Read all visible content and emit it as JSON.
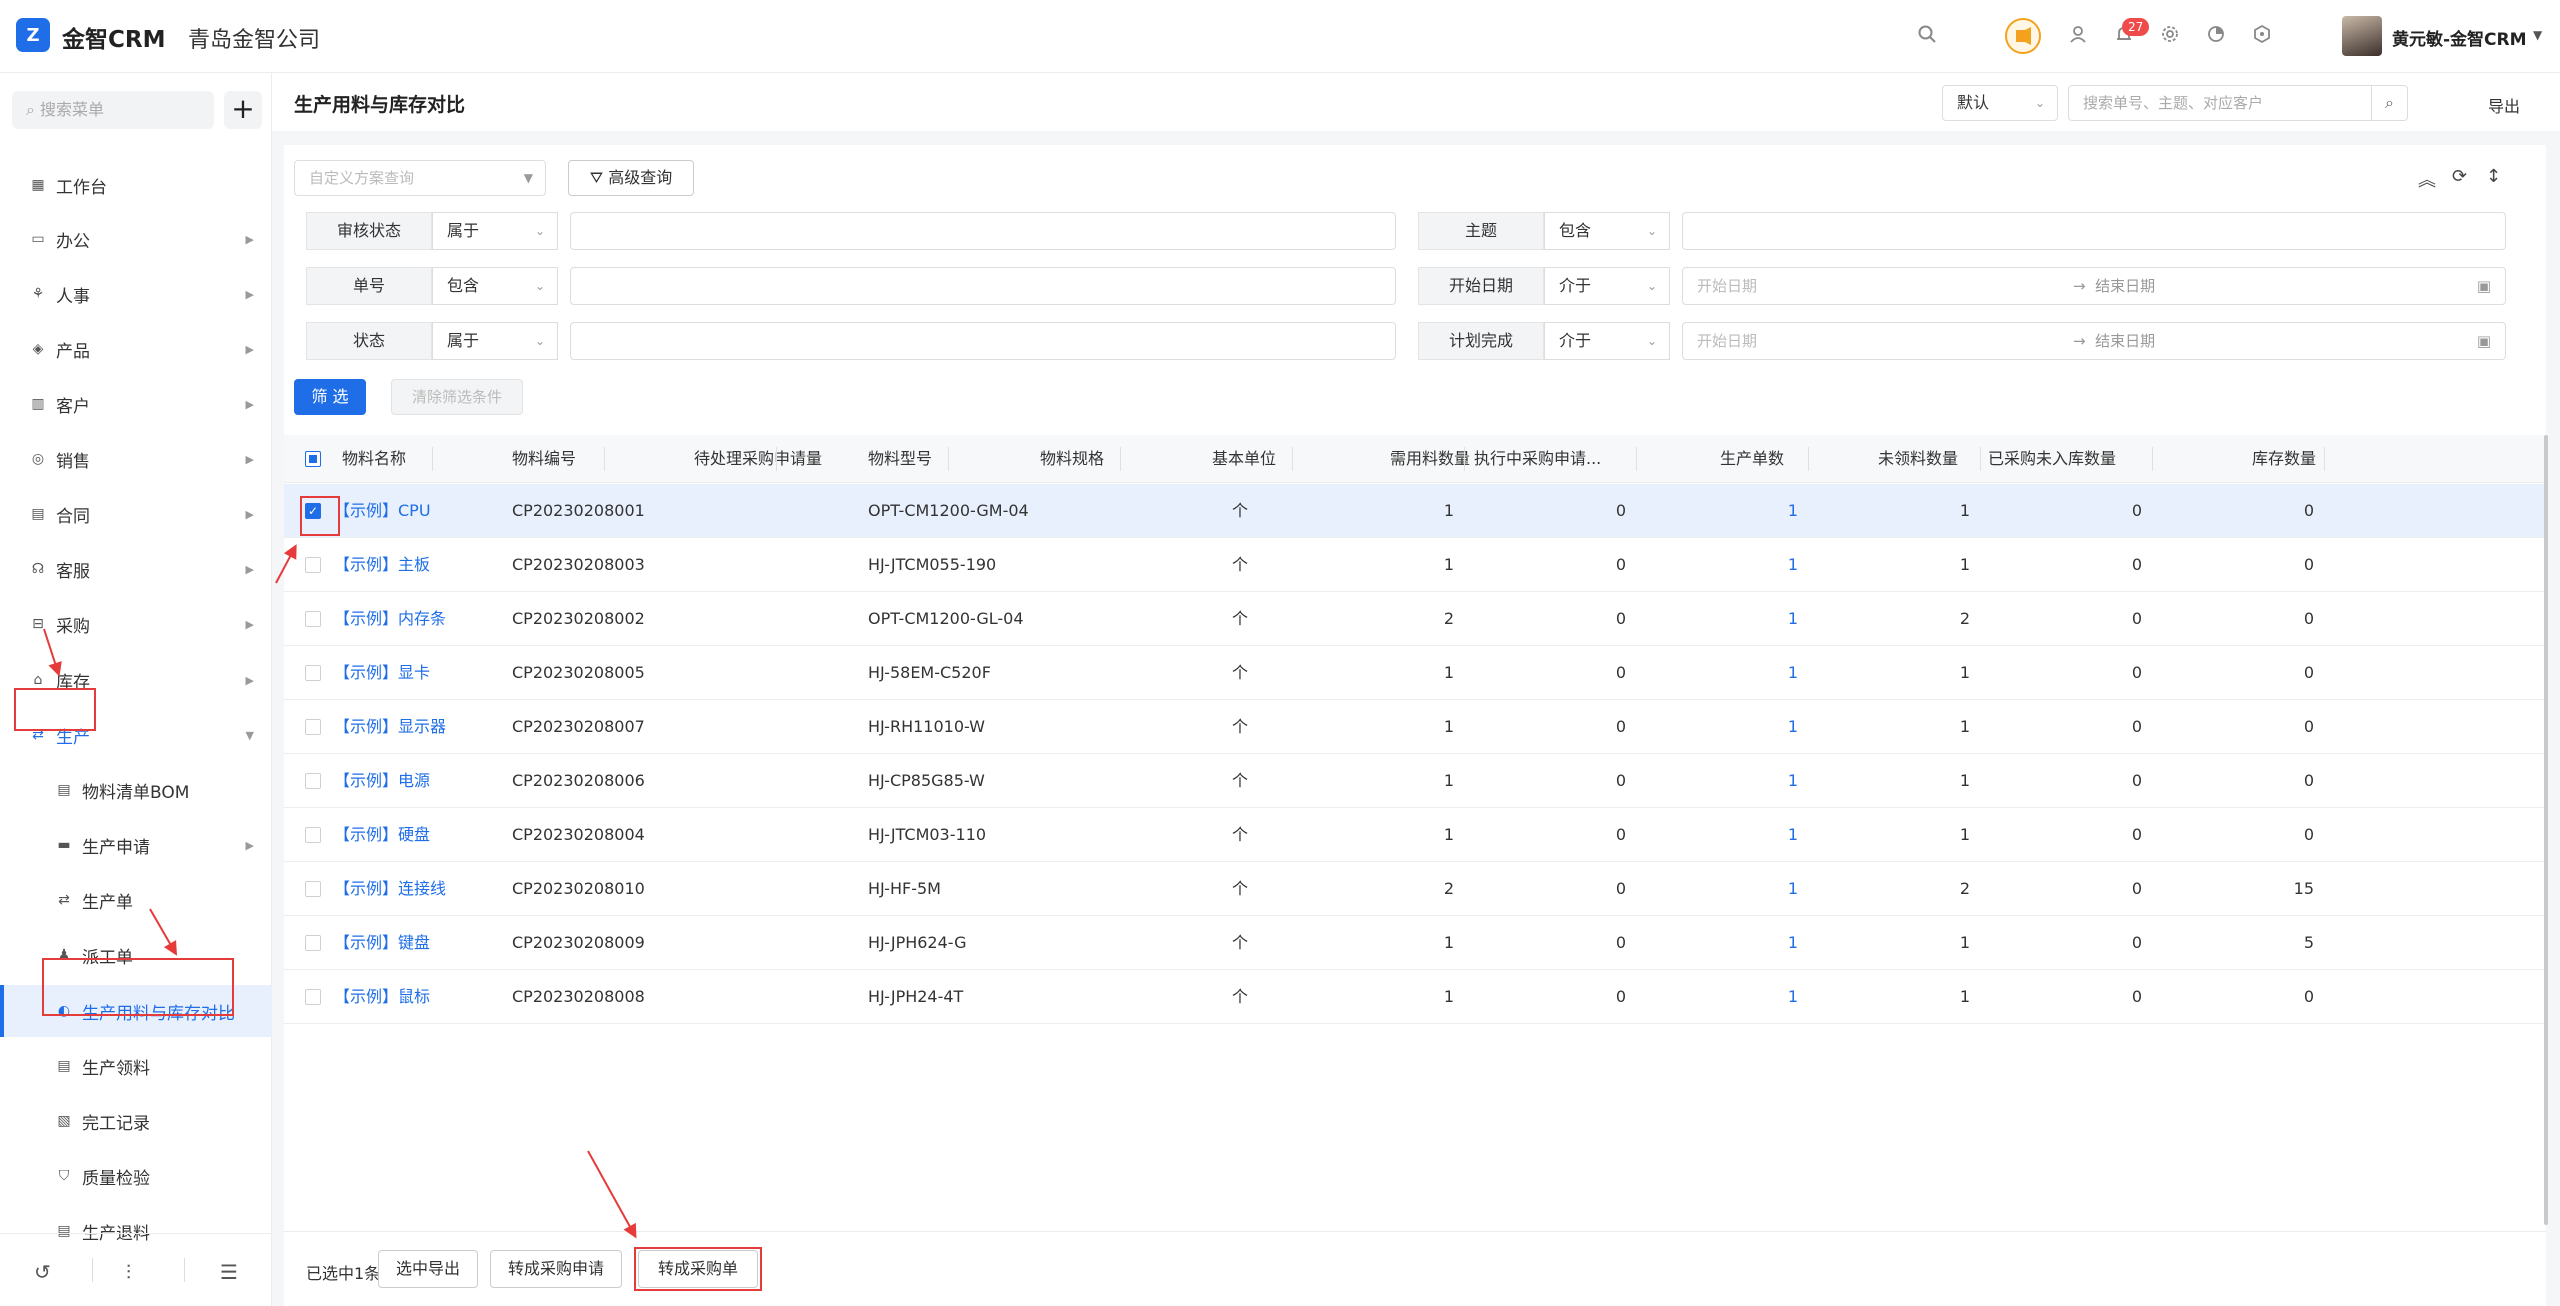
{
  "app": {
    "logo_mark": "Z",
    "logo_text": "金智CRM",
    "company": "青岛金智公司",
    "user_name": "黄元敏-金智CRM",
    "notification_count": "27"
  },
  "colors": {
    "primary": "#1f6ee8",
    "annotation": "#e63b3b"
  },
  "sidebar": {
    "search_placeholder": "搜索菜单",
    "items": [
      {
        "label": "工作台",
        "icon": "dashboard-icon"
      },
      {
        "label": "办公",
        "icon": "office-icon"
      },
      {
        "label": "人事",
        "icon": "hr-icon"
      },
      {
        "label": "产品",
        "icon": "product-icon"
      },
      {
        "label": "客户",
        "icon": "customer-icon"
      },
      {
        "label": "销售",
        "icon": "sales-icon"
      },
      {
        "label": "合同",
        "icon": "contract-icon"
      },
      {
        "label": "客服",
        "icon": "service-icon"
      },
      {
        "label": "采购",
        "icon": "purchase-icon"
      },
      {
        "label": "库存",
        "icon": "inventory-icon"
      },
      {
        "label": "生产",
        "icon": "production-icon"
      }
    ],
    "sub_items": [
      {
        "label": "物料清单BOM"
      },
      {
        "label": "生产申请"
      },
      {
        "label": "生产单"
      },
      {
        "label": "派工单"
      },
      {
        "label": "生产用料与库存对比"
      },
      {
        "label": "生产领料"
      },
      {
        "label": "完工记录"
      },
      {
        "label": "质量检验"
      },
      {
        "label": "生产退料"
      }
    ]
  },
  "page": {
    "title": "生产用料与库存对比",
    "view_select": "默认",
    "search_placeholder": "搜索单号、主题、对应客户",
    "export": "导出"
  },
  "filters": {
    "scheme_placeholder": "自定义方案查询",
    "advanced": "高级查询",
    "rows": [
      {
        "label": "审核状态",
        "op": "属于"
      },
      {
        "label": "单号",
        "op": "包含"
      },
      {
        "label": "状态",
        "op": "属于"
      }
    ],
    "right_rows": [
      {
        "label": "主题",
        "op": "包含"
      },
      {
        "label": "开始日期",
        "op": "介于",
        "start": "开始日期",
        "end": "结束日期"
      },
      {
        "label": "计划完成",
        "op": "介于",
        "start": "开始日期",
        "end": "结束日期"
      }
    ],
    "range_arrow": "→",
    "filter_btn": "筛 选",
    "clear_btn": "清除筛选条件"
  },
  "table": {
    "headers": [
      "物料名称",
      "物料编号",
      "待处理采购申请量",
      "物料型号",
      "物料规格",
      "基本单位",
      "需用料数量",
      "执行中采购申请...",
      "生产单数",
      "未领料数量",
      "已采购未入库数量",
      "库存数量"
    ],
    "rows": [
      {
        "name": "【示例】CPU",
        "code": "CP20230208001",
        "model": "OPT-CM1200-GM-04",
        "unit": "个",
        "need": "1",
        "exec": "0",
        "orders": "1",
        "unpicked": "1",
        "purchased": "0",
        "stock": "0",
        "checked": true
      },
      {
        "name": "【示例】主板",
        "code": "CP20230208003",
        "model": "HJ-JTCM055-190",
        "unit": "个",
        "need": "1",
        "exec": "0",
        "orders": "1",
        "unpicked": "1",
        "purchased": "0",
        "stock": "0",
        "checked": false
      },
      {
        "name": "【示例】内存条",
        "code": "CP20230208002",
        "model": "OPT-CM1200-GL-04",
        "unit": "个",
        "need": "2",
        "exec": "0",
        "orders": "1",
        "unpicked": "2",
        "purchased": "0",
        "stock": "0",
        "checked": false
      },
      {
        "name": "【示例】显卡",
        "code": "CP20230208005",
        "model": "HJ-58EM-C520F",
        "unit": "个",
        "need": "1",
        "exec": "0",
        "orders": "1",
        "unpicked": "1",
        "purchased": "0",
        "stock": "0",
        "checked": false
      },
      {
        "name": "【示例】显示器",
        "code": "CP20230208007",
        "model": "HJ-RH11010-W",
        "unit": "个",
        "need": "1",
        "exec": "0",
        "orders": "1",
        "unpicked": "1",
        "purchased": "0",
        "stock": "0",
        "checked": false
      },
      {
        "name": "【示例】电源",
        "code": "CP20230208006",
        "model": "HJ-CP85G85-W",
        "unit": "个",
        "need": "1",
        "exec": "0",
        "orders": "1",
        "unpicked": "1",
        "purchased": "0",
        "stock": "0",
        "checked": false
      },
      {
        "name": "【示例】硬盘",
        "code": "CP20230208004",
        "model": "HJ-JTCM03-110",
        "unit": "个",
        "need": "1",
        "exec": "0",
        "orders": "1",
        "unpicked": "1",
        "purchased": "0",
        "stock": "0",
        "checked": false
      },
      {
        "name": "【示例】连接线",
        "code": "CP20230208010",
        "model": "HJ-HF-5M",
        "unit": "个",
        "need": "2",
        "exec": "0",
        "orders": "1",
        "unpicked": "2",
        "purchased": "0",
        "stock": "15",
        "checked": false
      },
      {
        "name": "【示例】键盘",
        "code": "CP20230208009",
        "model": "HJ-JPH624-G",
        "unit": "个",
        "need": "1",
        "exec": "0",
        "orders": "1",
        "unpicked": "1",
        "purchased": "0",
        "stock": "5",
        "checked": false
      },
      {
        "name": "【示例】鼠标",
        "code": "CP20230208008",
        "model": "HJ-JPH24-4T",
        "unit": "个",
        "need": "1",
        "exec": "0",
        "orders": "1",
        "unpicked": "1",
        "purchased": "0",
        "stock": "0",
        "checked": false
      }
    ]
  },
  "footer": {
    "selected_count": "已选中1条",
    "export_selected": "选中导出",
    "to_purchase_request": "转成采购申请",
    "to_purchase_order": "转成采购单"
  }
}
